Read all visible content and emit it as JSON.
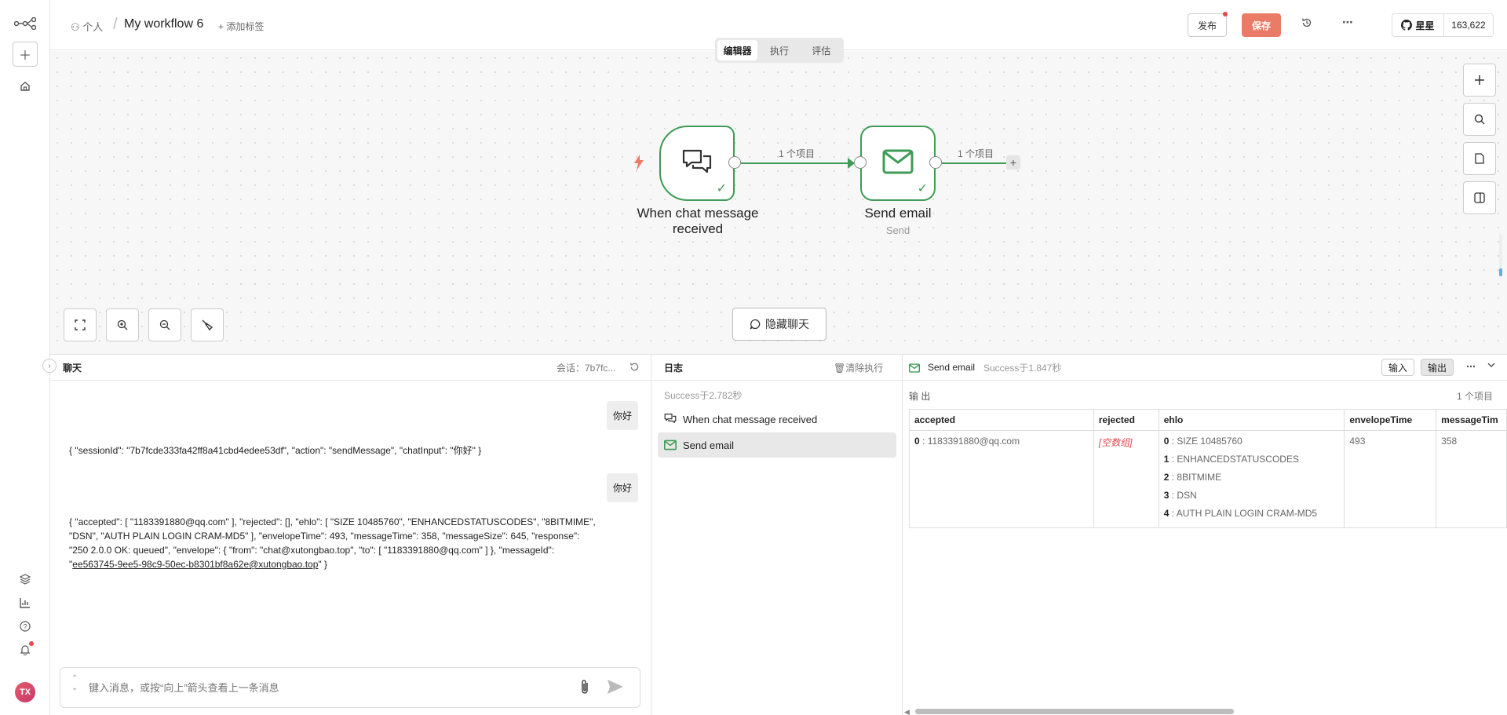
{
  "header": {
    "breadcrumb_person": "个人",
    "workflow_name": "My workflow 6",
    "add_tag": "+ 添加标签",
    "publish_label": "发布",
    "save_label": "保存",
    "github_star_label": "星星",
    "github_star_count": "163,622"
  },
  "canvas": {
    "tabs": [
      "编辑器",
      "执行",
      "评估"
    ],
    "active_tab": "编辑器",
    "nodes": [
      {
        "label_line1": "When chat message",
        "label_line2": "received",
        "sub": ""
      },
      {
        "label_line1": "Send email",
        "label_line2": "",
        "sub": "Send"
      }
    ],
    "connection_label_1": "1 个项目",
    "connection_label_2": "1 个项目",
    "hide_chat_label": "隐藏聊天"
  },
  "chat": {
    "title": "聊天",
    "session_label": "会话：7b7fc...",
    "messages": [
      {
        "role": "user",
        "text": "你好"
      },
      {
        "role": "bot",
        "text": "{ \"sessionId\": \"7b7fcde333fa42ff8a41cbd4edee53df\", \"action\": \"sendMessage\", \"chatInput\": \"你好\" }"
      },
      {
        "role": "user",
        "text": "你好"
      },
      {
        "role": "bot",
        "line1": "{ \"accepted\": [ \"1183391880@qq.com\" ], \"rejected\": [], \"ehlo\": [ \"SIZE 10485760\", \"ENHANCEDSTATUSCODES\", \"8BITMIME\",",
        "line2": "\"DSN\", \"AUTH PLAIN LOGIN CRAM-MD5\" ], \"envelopeTime\": 493, \"messageTime\": 358, \"messageSize\": 645, \"response\":",
        "line3": "\"250 2.0.0 OK: queued\", \"envelope\": { \"from\": \"chat@xutongbao.top\", \"to\": [ \"1183391880@qq.com\" ] }, \"messageId\":",
        "line4_pre": "\"",
        "line4_link": "ee563745-9ee5-98c9-50ec-b8301bf8a62e@xutongbao.top",
        "line4_post": "\" }"
      }
    ],
    "input_placeholder": "键入消息，或按“向上”箭头查看上一条消息"
  },
  "logs": {
    "title": "日志",
    "clear_label": "清除执行",
    "summary": "Success于2.782秒",
    "items": [
      {
        "label": "When chat message received",
        "selected": false
      },
      {
        "label": "Send email",
        "selected": true
      }
    ]
  },
  "output": {
    "node_name": "Send email",
    "status": "Success于1.847秒",
    "input_btn": "输入",
    "output_btn": "输出",
    "section_label": "输 出",
    "item_count": "1 个项目",
    "columns": [
      "accepted",
      "rejected",
      "ehlo",
      "envelopeTime",
      "messageTim"
    ],
    "accepted": {
      "idx": "0",
      "val": "1183391880@qq.com"
    },
    "rejected_empty": "[空数组]",
    "ehlo": [
      {
        "idx": "0",
        "val": "SIZE 10485760"
      },
      {
        "idx": "1",
        "val": "ENHANCEDSTATUSCODES"
      },
      {
        "idx": "2",
        "val": "8BITMIME"
      },
      {
        "idx": "3",
        "val": "DSN"
      },
      {
        "idx": "4",
        "val": "AUTH PLAIN LOGIN CRAM-MD5"
      }
    ],
    "envelopeTime": "493",
    "messageTime": "358"
  },
  "colors": {
    "accent": "#ea7b66",
    "success": "#3f9b55",
    "trigger": "#ea7b66"
  }
}
